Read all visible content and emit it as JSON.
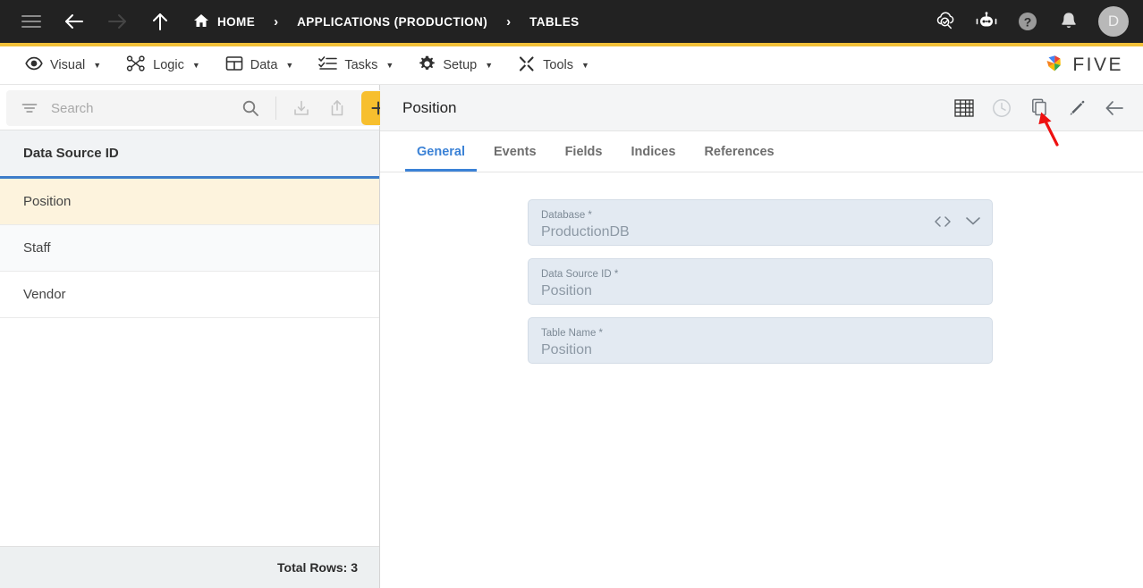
{
  "topbar": {
    "menu_icon": "hamburger-icon",
    "back_icon": "arrow-left-icon",
    "forward_icon": "arrow-right-icon",
    "up_icon": "arrow-up-icon",
    "breadcrumbs": [
      {
        "label": "HOME",
        "icon": "home-icon"
      },
      {
        "label": "APPLICATIONS (PRODUCTION)",
        "icon": ""
      },
      {
        "label": "TABLES",
        "icon": ""
      }
    ],
    "separator": "›",
    "right_icons": [
      "cloud-check-search-icon",
      "robot-assistant-icon",
      "help-question-icon",
      "notification-bell-icon"
    ],
    "avatar_initial": "D",
    "accent_color": "#f2c038"
  },
  "menubar": {
    "items": [
      {
        "label": "Visual",
        "icon": "eye-icon"
      },
      {
        "label": "Logic",
        "icon": "node-graph-icon"
      },
      {
        "label": "Data",
        "icon": "grid-table-icon"
      },
      {
        "label": "Tasks",
        "icon": "checklist-icon"
      },
      {
        "label": "Setup",
        "icon": "gear-icon"
      },
      {
        "label": "Tools",
        "icon": "wrench-screwdriver-icon"
      }
    ],
    "caret": "▼",
    "logo_text": "FIVE"
  },
  "left_panel": {
    "search": {
      "placeholder": "Search",
      "value": "",
      "filter_icon": "filter-icon",
      "search_icon": "search-icon",
      "import_icon": "import-download-icon",
      "export_icon": "export-upload-icon",
      "add_label": "+"
    },
    "column_header": "Data Source ID",
    "rows": [
      {
        "label": "Position",
        "selected": true
      },
      {
        "label": "Staff",
        "selected": false
      },
      {
        "label": "Vendor",
        "selected": false
      }
    ],
    "footer_text": "Total Rows: 3",
    "selected_row_color": "#fdf3dd",
    "header_underline_color": "#3d7dc9"
  },
  "right_panel": {
    "title": "Position",
    "header_icons": [
      "table-grid-icon",
      "history-clock-icon",
      "copy-duplicate-icon",
      "edit-pencil-icon",
      "back-arrow-icon"
    ],
    "tabs": [
      {
        "label": "General",
        "active": true
      },
      {
        "label": "Events",
        "active": false
      },
      {
        "label": "Fields",
        "active": false
      },
      {
        "label": "Indices",
        "active": false
      },
      {
        "label": "References",
        "active": false
      }
    ],
    "active_tab_color": "#3b82d6",
    "fields": [
      {
        "label": "Database *",
        "value": "ProductionDB",
        "has_code_icon": true,
        "has_dropdown": true
      },
      {
        "label": "Data Source ID *",
        "value": "Position",
        "has_code_icon": false,
        "has_dropdown": false
      },
      {
        "label": "Table Name *",
        "value": "Position",
        "has_code_icon": false,
        "has_dropdown": false
      }
    ]
  },
  "annotation": {
    "type": "red-arrow",
    "color": "#ee1111",
    "points_to": "edit-pencil-icon"
  }
}
